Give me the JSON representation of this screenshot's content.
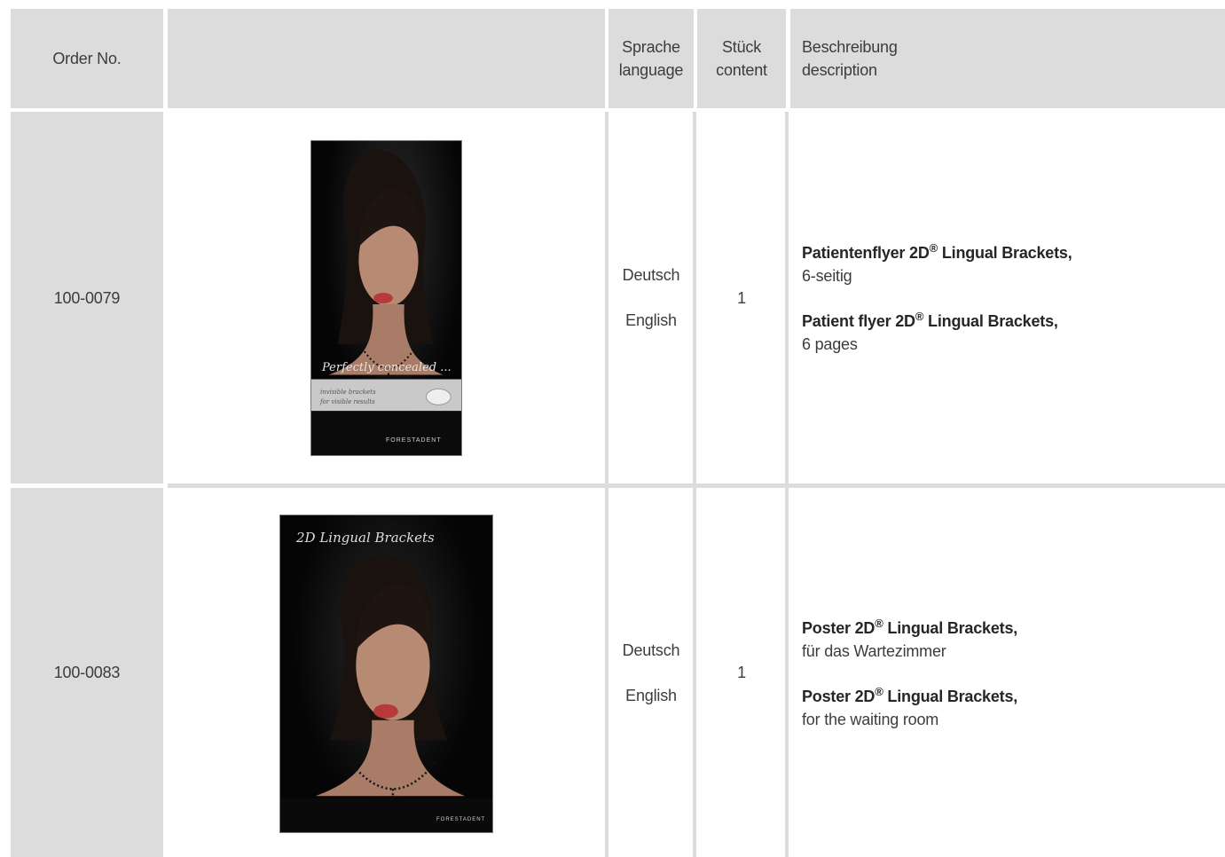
{
  "header": {
    "order_no": "Order No.",
    "image_col": "",
    "language_de": "Sprache",
    "language_en": "language",
    "content_de": "Stück",
    "content_en": "content",
    "description_de": "Beschreibung",
    "description_en": "description"
  },
  "rows": [
    {
      "order_no": "100-0079",
      "languages": [
        "Deutsch",
        "English"
      ],
      "content": "1",
      "desc_de_title": "Patientenflyer 2D",
      "desc_de_title_suffix": " Lingual Brackets,",
      "desc_de_detail": "6-seitig",
      "desc_en_title": "Patient flyer 2D",
      "desc_en_title_suffix": " Lingual Brackets,",
      "desc_en_detail": "6 pages",
      "registered": "®",
      "image": {
        "type": "flyer",
        "overlay": "Perfectly concealed ...",
        "band_line1": "invisible brackets",
        "band_line2": "for visible results",
        "brand": "FORESTADENT"
      }
    },
    {
      "order_no": "100-0083",
      "languages": [
        "Deutsch",
        "English"
      ],
      "content": "1",
      "desc_de_title": "Poster 2D",
      "desc_de_title_suffix": " Lingual Brackets,",
      "desc_de_detail": "für das Wartezimmer",
      "desc_en_title": "Poster 2D",
      "desc_en_title_suffix": " Lingual Brackets,",
      "desc_en_detail": "for the waiting room",
      "registered": "®",
      "image": {
        "type": "poster",
        "overlay": "2D Lingual Brackets",
        "brand": "FORESTADENT"
      }
    }
  ]
}
